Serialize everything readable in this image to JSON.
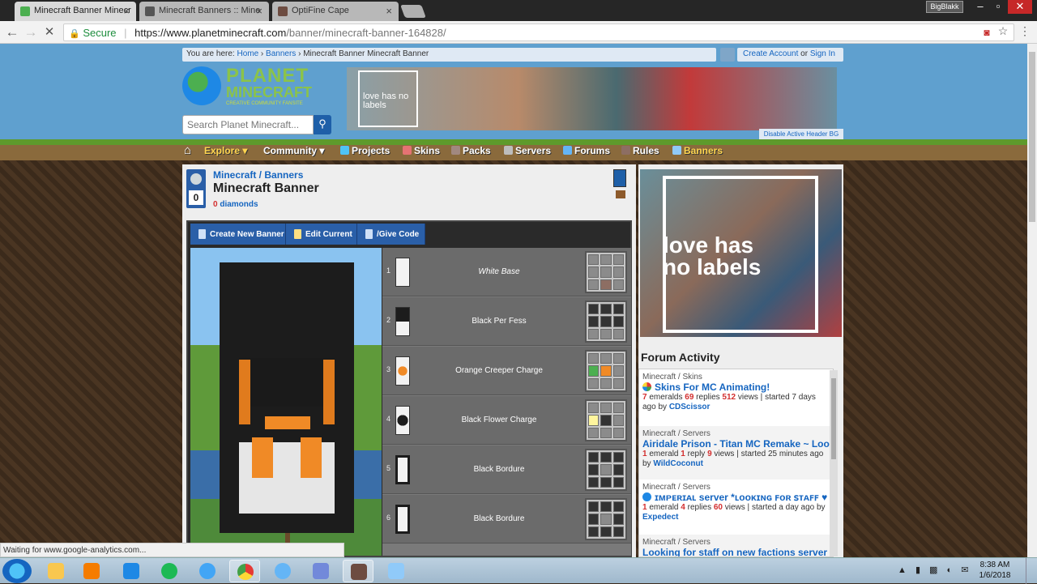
{
  "browser": {
    "tabs": [
      {
        "title": "Minecraft Banner Minecr",
        "active": true
      },
      {
        "title": "Minecraft Banners :: Mine",
        "active": false
      },
      {
        "title": "OptiFine Cape",
        "active": false
      }
    ],
    "user_badge": "BigBlakk",
    "secure_label": "Secure",
    "url_host": "https://www.planetminecraft.com",
    "url_path": "/banner/minecraft-banner-164828/"
  },
  "site": {
    "breadcrumb_prefix": "You are here:",
    "breadcrumb": [
      "Home",
      "Banners",
      "Minecraft Banner Minecraft Banner"
    ],
    "create_account": "Create Account",
    "or": "or",
    "sign_in": "Sign In",
    "logo_line1": "PLANET",
    "logo_line2": "MINECRAFT",
    "logo_tag": "CREATIVE COMMUNITY FANSITE",
    "search_placeholder": "Search Planet Minecraft...",
    "ad_text": "love has no labels",
    "disable_bg": "Disable Active Header BG",
    "nav": [
      "Explore",
      "Community",
      "Projects",
      "Skins",
      "Packs",
      "Servers",
      "Forums",
      "Rules",
      "Banners"
    ]
  },
  "banner_page": {
    "category": "Minecraft",
    "subcategory": "Banners",
    "title": "Minecraft Banner",
    "diamond_count": "0",
    "diamonds_label": "diamonds",
    "buttons": [
      "Create New Banner",
      "Edit Current",
      "/Give Code"
    ],
    "layers": [
      {
        "num": "1",
        "name": "White Base",
        "thumb_color": "#f2f2f2"
      },
      {
        "num": "2",
        "name": "Black Per Fess",
        "thumb_color": "#1c1c1c"
      },
      {
        "num": "3",
        "name": "Orange Creeper Charge",
        "thumb_color": "#f08a26"
      },
      {
        "num": "4",
        "name": "Black Flower Charge",
        "thumb_color": "#1c1c1c"
      },
      {
        "num": "5",
        "name": "Black Bordure",
        "thumb_color": "#1c1c1c"
      },
      {
        "num": "6",
        "name": "Black Bordure",
        "thumb_color": "#1c1c1c"
      }
    ]
  },
  "sidebar": {
    "ad_text": "love has no labels",
    "forum_activity_title": "Forum Activity",
    "threads": [
      {
        "category": "Minecraft / Skins",
        "title": "Skins For MC Animating!",
        "emeralds": "7",
        "emeralds_label": "emeralds",
        "replies": "69",
        "replies_label": "replies",
        "views": "512",
        "views_label": "views",
        "started": "started 7 days ago by",
        "by": "CDScissor"
      },
      {
        "category": "Minecraft / Servers",
        "title": "Airidale Prison - Titan MC Remake ~ Looki...",
        "emeralds": "1",
        "emeralds_label": "emerald",
        "replies": "1",
        "replies_label": "reply",
        "views": "9",
        "views_label": "views",
        "started": "started 25 minutes ago by",
        "by": "WildCoconut"
      },
      {
        "category": "Minecraft / Servers",
        "title": "ɪᴍᴘᴇʀɪᴀʟ server *ʟᴏᴏᴋɪɴɢ ꜰᴏʀ ꜱᴛᴀꜰꜰ ♥",
        "emeralds": "1",
        "emeralds_label": "emerald",
        "replies": "4",
        "replies_label": "replies",
        "views": "60",
        "views_label": "views",
        "started": "started a day ago by",
        "by": "Expedect"
      },
      {
        "category": "Minecraft / Servers",
        "title": "Looking for staff on new factions server",
        "emeralds": "",
        "emeralds_label": "",
        "replies": "",
        "replies_label": "",
        "views": "",
        "views_label": "",
        "started": "",
        "by": ""
      }
    ]
  },
  "status_text": "Waiting for www.google-analytics.com...",
  "clock": {
    "time": "8:38 AM",
    "date": "1/6/2018"
  }
}
